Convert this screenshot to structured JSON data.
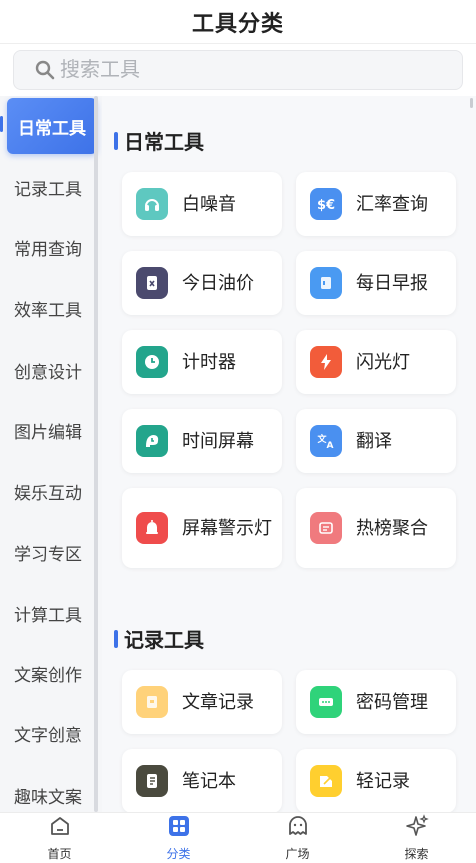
{
  "header": {
    "title": "工具分类"
  },
  "search": {
    "placeholder": "搜索工具"
  },
  "sidebar": {
    "items": [
      {
        "label": "日常工具",
        "active": true
      },
      {
        "label": "记录工具"
      },
      {
        "label": "常用查询"
      },
      {
        "label": "效率工具"
      },
      {
        "label": "创意设计"
      },
      {
        "label": "图片编辑"
      },
      {
        "label": "娱乐互动"
      },
      {
        "label": "学习专区"
      },
      {
        "label": "计算工具"
      },
      {
        "label": "文案创作"
      },
      {
        "label": "文字创意"
      },
      {
        "label": "趣味文案"
      }
    ]
  },
  "sections": [
    {
      "title": "日常工具",
      "tools": [
        {
          "label": "白噪音",
          "icon": "headphones-icon",
          "color": "#5ec8c0"
        },
        {
          "label": "汇率查询",
          "icon": "currency-icon",
          "color": "#4a90f0"
        },
        {
          "label": "今日油价",
          "icon": "fuel-icon",
          "color": "#4b4a6e"
        },
        {
          "label": "每日早报",
          "icon": "newspaper-icon",
          "color": "#4a9af2"
        },
        {
          "label": "计时器",
          "icon": "clock-icon",
          "color": "#23a58c"
        },
        {
          "label": "闪光灯",
          "icon": "flash-icon",
          "color": "#f25c3a"
        },
        {
          "label": "时间屏幕",
          "icon": "time-screen-icon",
          "color": "#23a58c"
        },
        {
          "label": "翻译",
          "icon": "translate-icon",
          "color": "#4a90f0"
        },
        {
          "label": "屏幕警示灯",
          "icon": "alarm-bell-icon",
          "color": "#ef4c4c"
        },
        {
          "label": "热榜聚合",
          "icon": "hot-list-icon",
          "color": "#f07a7e"
        }
      ]
    },
    {
      "title": "记录工具",
      "tools": [
        {
          "label": "文章记录",
          "icon": "article-icon",
          "color": "#ffd27a"
        },
        {
          "label": "密码管理",
          "icon": "password-icon",
          "color": "#2fd37a"
        },
        {
          "label": "笔记本",
          "icon": "notebook-icon",
          "color": "#4a4a3e"
        },
        {
          "label": "轻记录",
          "icon": "light-note-icon",
          "color": "#ffcf2f"
        }
      ]
    }
  ],
  "tabbar": {
    "items": [
      {
        "label": "首页",
        "icon": "home-icon"
      },
      {
        "label": "分类",
        "icon": "category-grid-icon",
        "active": true
      },
      {
        "label": "广场",
        "icon": "ghost-icon"
      },
      {
        "label": "探索",
        "icon": "sparkle-icon"
      }
    ]
  },
  "colors": {
    "accent": "#3d72e8"
  }
}
